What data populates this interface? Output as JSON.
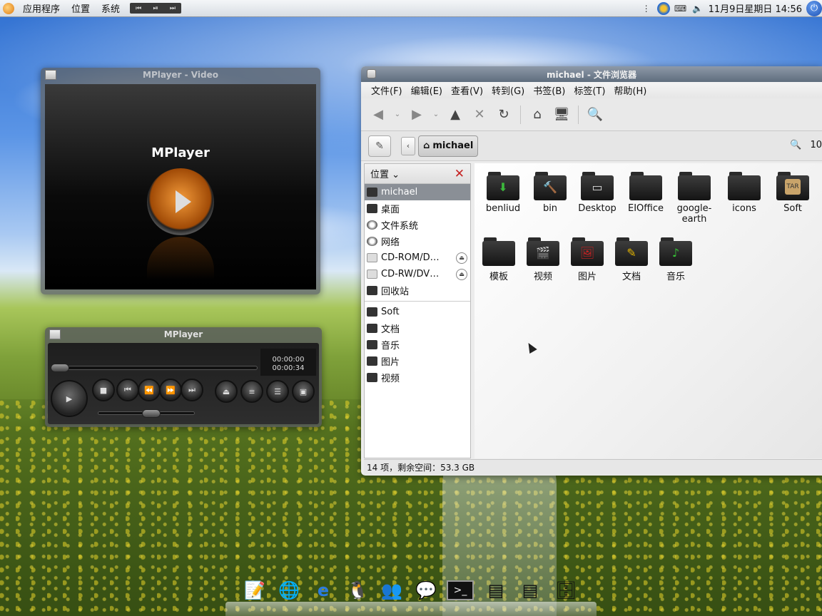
{
  "top_panel": {
    "menus": [
      "应用程序",
      "位置",
      "系统"
    ],
    "media_controls": [
      "⏮",
      "⏯",
      "⏭"
    ],
    "clock": "11月9日星期日 14:56",
    "tray_icons": [
      "qq-swirl-icon",
      "keyboard-icon",
      "volume-icon",
      "power-icon"
    ]
  },
  "mplayer_video": {
    "title": "MPlayer - Video",
    "brand": "MPlayer"
  },
  "mplayer_ctrl": {
    "title": "MPlayer",
    "time_elapsed": "00:00:00",
    "time_total": "00:00:34",
    "buttons": [
      "play",
      "stop",
      "previous",
      "rewind",
      "forward",
      "next",
      "eject",
      "equalizer",
      "playlist",
      "fullscreen"
    ]
  },
  "browser": {
    "title": "michael - 文件浏览器",
    "menus": [
      "文件(F)",
      "编辑(E)",
      "查看(V)",
      "转到(G)",
      "书签(B)",
      "标签(T)",
      "帮助(H)"
    ],
    "crumb": "michael",
    "zoom": "10",
    "side_header": "位置",
    "places": [
      {
        "label": "michael",
        "selected": true
      },
      {
        "label": "桌面"
      },
      {
        "label": "文件系统"
      },
      {
        "label": "网络"
      },
      {
        "label": "CD-ROM/D…",
        "eject": true
      },
      {
        "label": "CD-RW/DV…",
        "eject": true
      },
      {
        "label": "回收站"
      }
    ],
    "bookmarks": [
      "Soft",
      "文档",
      "音乐",
      "图片",
      "视频"
    ],
    "files": [
      {
        "label": "benliud",
        "emblem": "⬇",
        "emblem_color": "#3cb83c"
      },
      {
        "label": "bin",
        "emblem": "🔨",
        "emblem_color": "#c08a3a"
      },
      {
        "label": "Desktop",
        "emblem": "▭",
        "emblem_color": "#dddddd"
      },
      {
        "label": "EIOffice",
        "emblem": "",
        "emblem_color": "#ffffff"
      },
      {
        "label": "google-earth",
        "emblem": "",
        "emblem_color": "#ffffff"
      },
      {
        "label": "icons",
        "emblem": "",
        "emblem_color": "#ffffff"
      },
      {
        "label": "Soft",
        "emblem": "TAR",
        "emblem_color": "#c9a46a"
      },
      {
        "label": "模板",
        "emblem": "",
        "emblem_color": "#ffffff"
      },
      {
        "label": "视频",
        "emblem": "🎬",
        "emblem_color": "#dddddd"
      },
      {
        "label": "图片",
        "emblem": "🖼",
        "emblem_color": "#c22"
      },
      {
        "label": "文档",
        "emblem": "✎",
        "emblem_color": "#e2b300"
      },
      {
        "label": "音乐",
        "emblem": "♪",
        "emblem_color": "#36c236"
      }
    ],
    "status": "14 项，剩余空间：53.3 GB"
  },
  "dock": {
    "items": [
      "text-editor-icon",
      "browser-globe-icon",
      "internet-explorer-icon",
      "qq-penguin-icon",
      "chat-icon",
      "messenger-icon",
      "terminal-icon",
      "notes-icon",
      "notes-icon",
      "file-cabinet-icon"
    ],
    "glyphs": [
      "📝",
      "🌐",
      "e",
      "🐧",
      "👥",
      "💬",
      ">_",
      "▤",
      "▤",
      "🗄"
    ]
  }
}
